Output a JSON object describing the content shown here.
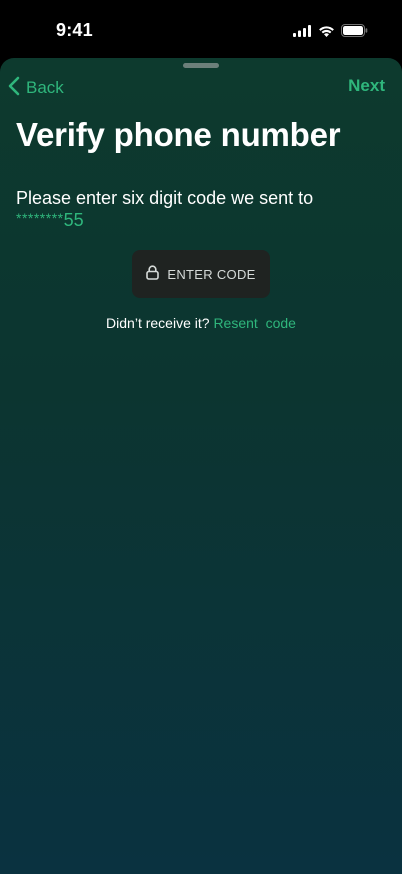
{
  "status_bar": {
    "time": "9:41",
    "icons": [
      "cellular-signal-icon",
      "wifi-icon",
      "battery-icon"
    ]
  },
  "nav": {
    "back_label": "Back",
    "next_label": "Next"
  },
  "title": "Verify phone number",
  "description": "Please enter six digit code we sent to",
  "masked_number": {
    "stars": "********",
    "digits": "55"
  },
  "code_button": {
    "label": "ENTER CODE",
    "icon": "lock-icon"
  },
  "resend": {
    "prompt": "Didn’t receive it?",
    "link": "Resent  code"
  },
  "colors": {
    "accent": "#2fb67c",
    "sheet_top": "#0d3a2e",
    "sheet_bottom": "#0a3240",
    "button_bg": "#1f2321"
  }
}
